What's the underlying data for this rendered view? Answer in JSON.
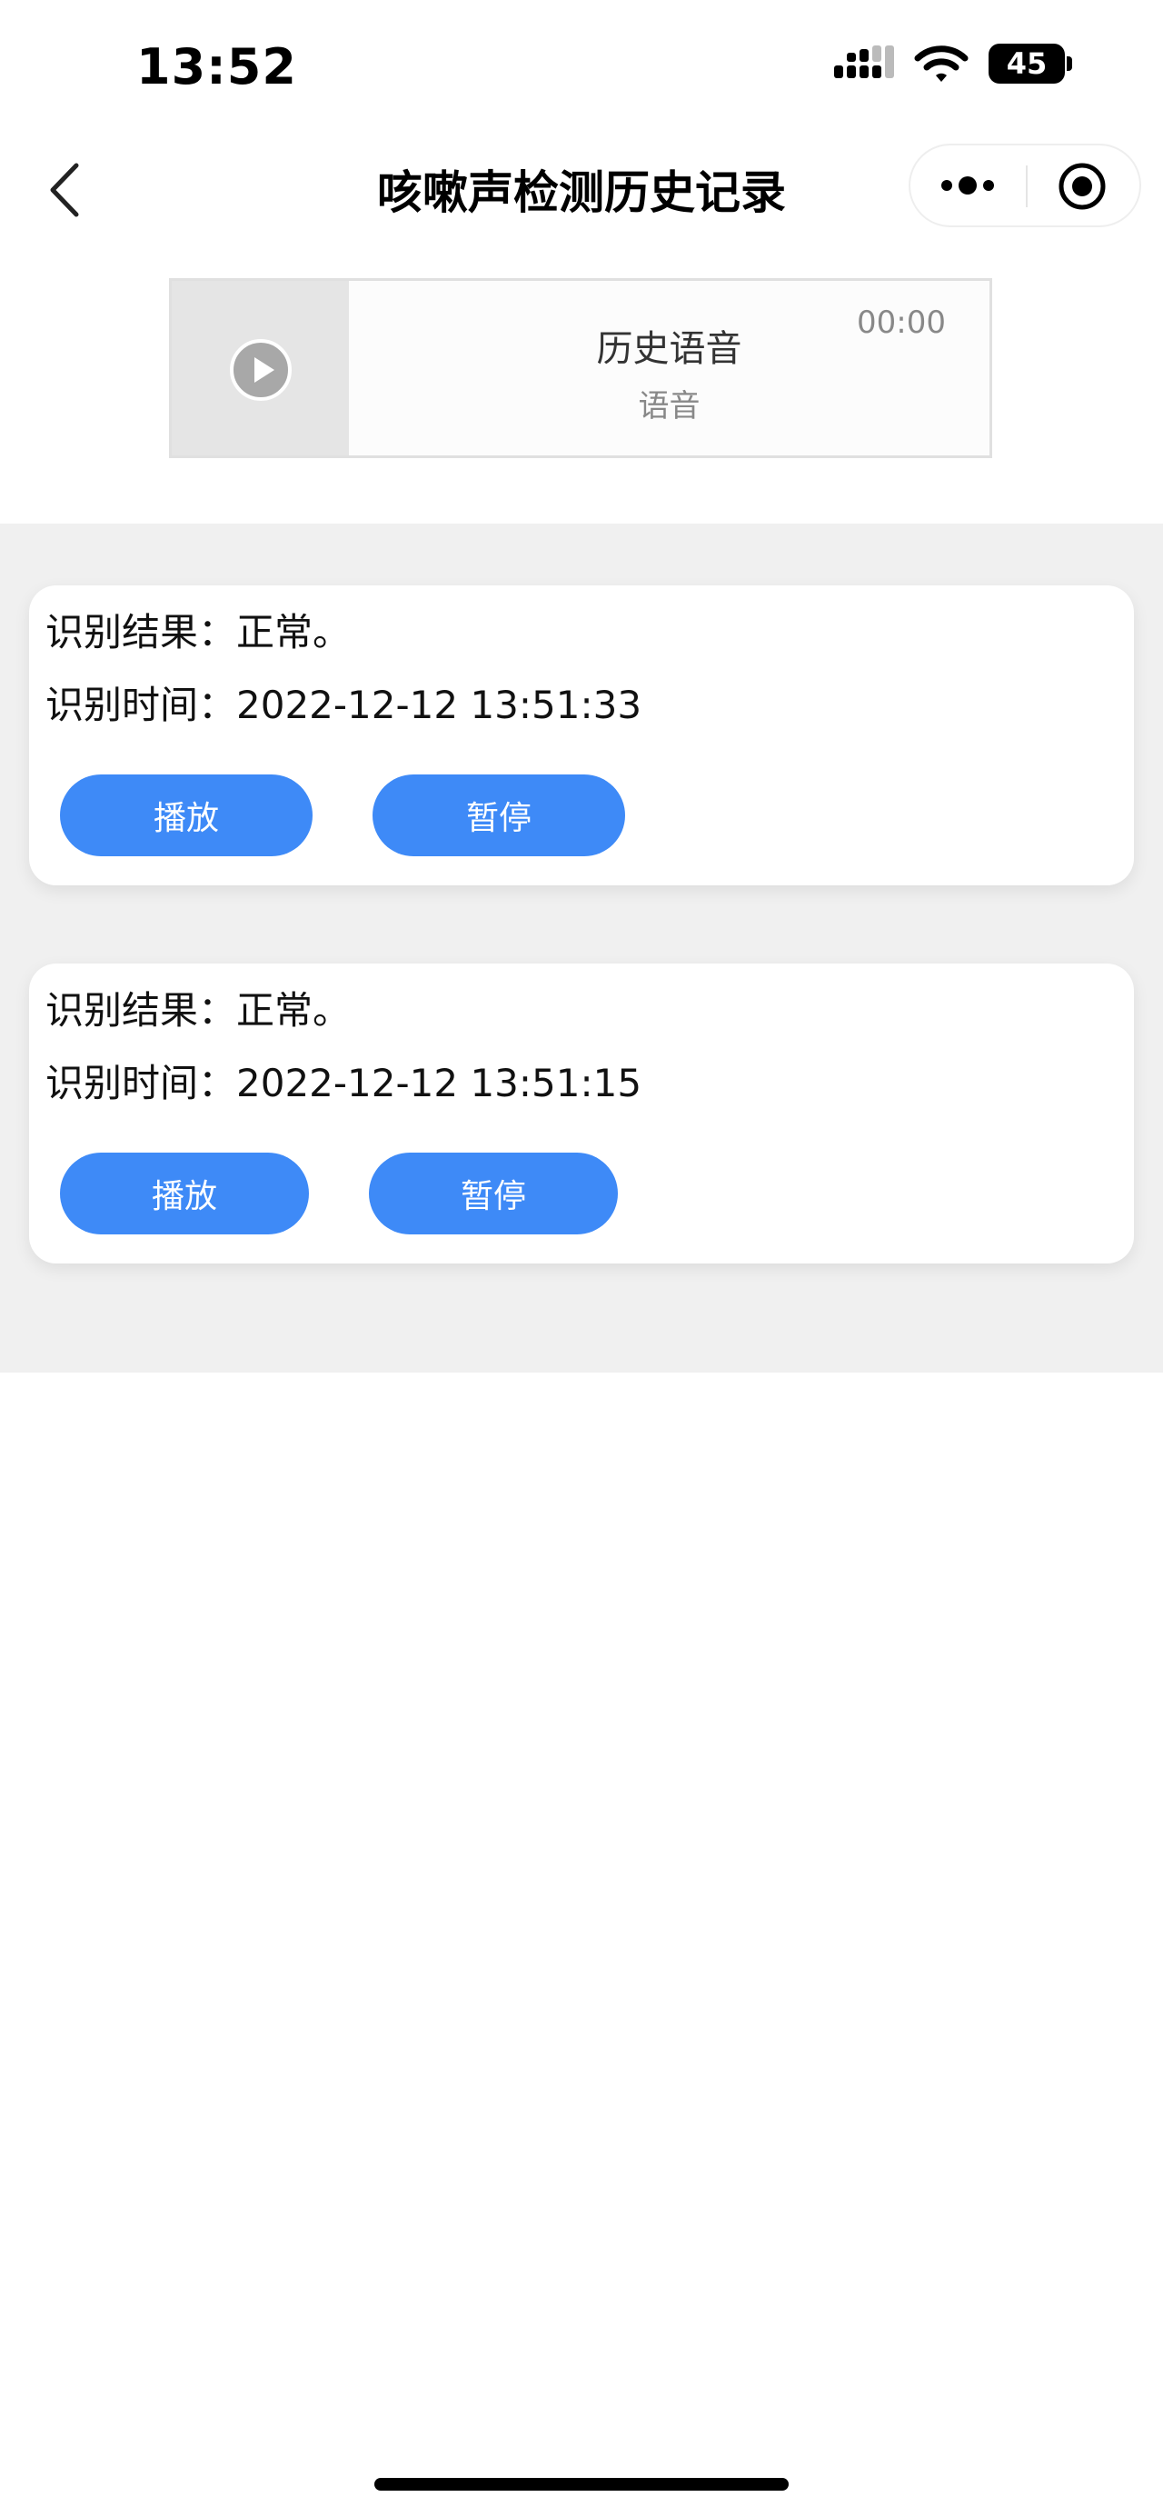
{
  "status_bar": {
    "time": "13:52",
    "battery": "45",
    "icons": [
      "signal-icon",
      "wifi-icon",
      "battery-icon"
    ]
  },
  "nav": {
    "title": "咳嗽声检测历史记录",
    "back_icon": "chevron-left-icon",
    "capsule_icons": [
      "more-dots-icon",
      "close-target-icon"
    ]
  },
  "audio": {
    "name": "历史语音",
    "author": "语音",
    "time": "00:00",
    "play_icon": "play-icon"
  },
  "records": [
    {
      "result_label": "识别结果：",
      "result_value": "正常。",
      "time_label": "识别时间：",
      "time_value": "2022-12-12 13:51:33",
      "play_label": "播放",
      "pause_label": "暂停"
    },
    {
      "result_label": "识别结果：",
      "result_value": "正常。",
      "time_label": "识别时间：",
      "time_value": "2022-12-12 13:51:15",
      "play_label": "播放",
      "pause_label": "暂停"
    }
  ],
  "colors": {
    "accent": "#3e8af7",
    "list_background": "#f0f0f0",
    "card_background": "#ffffff"
  }
}
